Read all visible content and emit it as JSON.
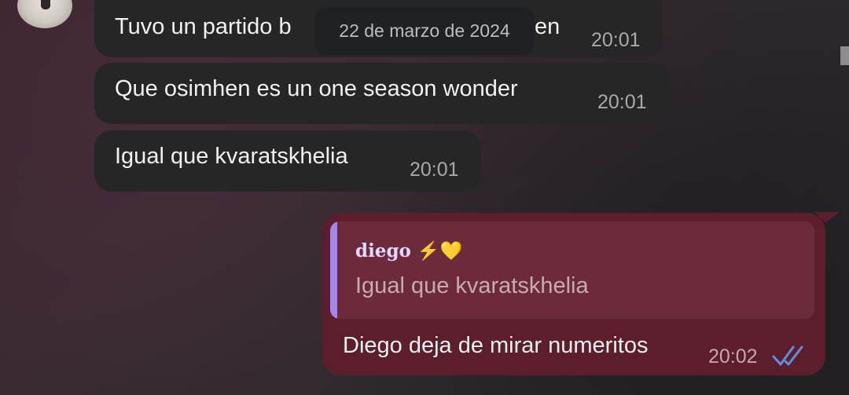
{
  "chat": {
    "sender_name": "diego",
    "sender_emojis": "⚡💛",
    "date_label": "22 de marzo de 2024",
    "messages_in": [
      {
        "text_before": "Tuvo un partido b",
        "text_after": "en",
        "time": "20:01"
      },
      {
        "text": "Que osimhen es un one season wonder",
        "time": "20:01"
      },
      {
        "text": "Igual que kvaratskhelia",
        "time": "20:01"
      }
    ],
    "message_out": {
      "reply_to_name": "diego",
      "reply_to_emojis": "⚡💛",
      "reply_to_text": "Igual que kvaratskhelia",
      "text": "Diego deja de mirar numeritos",
      "time": "20:02",
      "status_icon": "double-check-icon"
    }
  },
  "colors": {
    "incoming_bubble": "#262626",
    "outgoing_bubble": "#5c1e2d",
    "reply_accent": "#a787e6",
    "read_check": "#5b8fd9"
  }
}
